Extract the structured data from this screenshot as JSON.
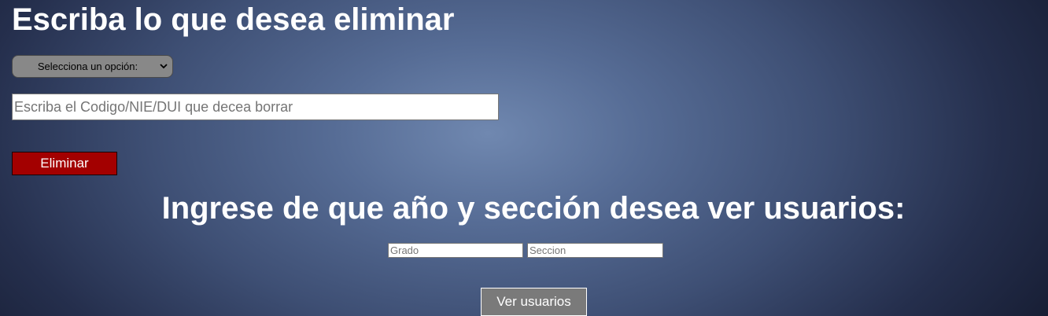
{
  "delete_section": {
    "title": "Escriba lo que desea eliminar",
    "option_select": {
      "selected": "Selecciona un opción:",
      "icon": "chevron-down-icon"
    },
    "code_input": {
      "value": "",
      "placeholder": "Escriba el Codigo/NIE/DUI que decea borrar"
    },
    "delete_button_label": "Eliminar"
  },
  "users_section": {
    "title": "Ingrese de que año y sección desea ver usuarios:",
    "grade_input": {
      "value": "",
      "placeholder": "Grado"
    },
    "section_input": {
      "value": "",
      "placeholder": "Seccion"
    },
    "view_button_label": "Ver usuarios"
  },
  "colors": {
    "delete_button": "#a30000",
    "view_button": "#7a7a7a",
    "select_background": "#888888",
    "text": "#ffffff"
  }
}
